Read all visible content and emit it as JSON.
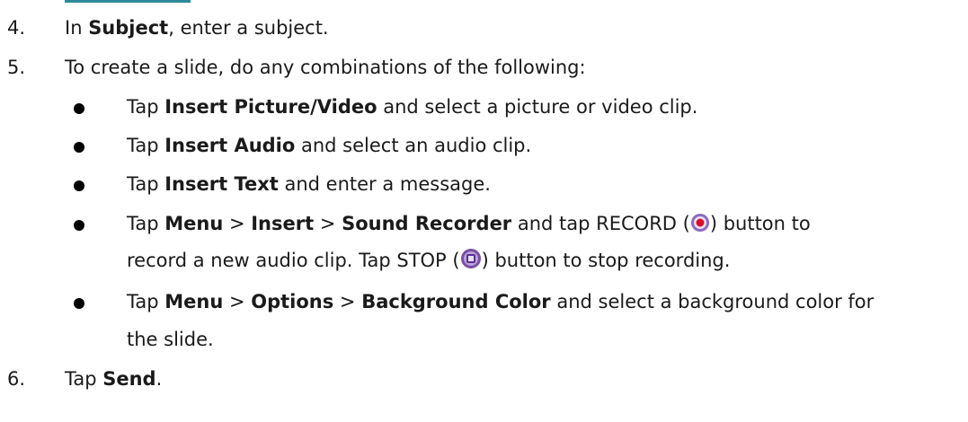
{
  "steps": {
    "s4": {
      "num": "4.",
      "pre": "In ",
      "bold": "Subject",
      "post": ", enter a subject."
    },
    "s5": {
      "num": "5.",
      "text": "To create a slide, do any combinations of the following:"
    },
    "s6": {
      "num": "6.",
      "pre": "Tap ",
      "bold": "Send",
      "post": "."
    }
  },
  "bullets": {
    "b1": {
      "pre": "Tap ",
      "bold": "Insert Picture/Video",
      "post": " and select a picture or video clip."
    },
    "b2": {
      "pre": "Tap ",
      "bold": "Insert Audio",
      "post": " and select an audio clip."
    },
    "b3": {
      "pre": "Tap ",
      "bold": "Insert Text",
      "post": " and enter a message."
    },
    "b4": {
      "t1": "Tap ",
      "menu": "Menu",
      "sep1": " > ",
      "insert": "Insert",
      "sep2": " > ",
      "recorder": "Sound Recorder",
      "t2": " and tap RECORD (",
      "t3": ") button to",
      "line2a": "record a new audio clip. Tap STOP (",
      "line2b": ") button to stop recording."
    },
    "b5": {
      "t1": "Tap ",
      "menu": "Menu",
      "sep1": " > ",
      "options": "Options",
      "sep2": " > ",
      "bgcolor": "Background Color",
      "t2": " and select a background color for",
      "line2": "the slide."
    }
  },
  "icons": {
    "record": "record-icon",
    "stop": "stop-icon"
  },
  "colors": {
    "accent_rule": "#2e8a9a",
    "icon_purple": "#7a4fa3",
    "icon_red": "#d8102a"
  }
}
